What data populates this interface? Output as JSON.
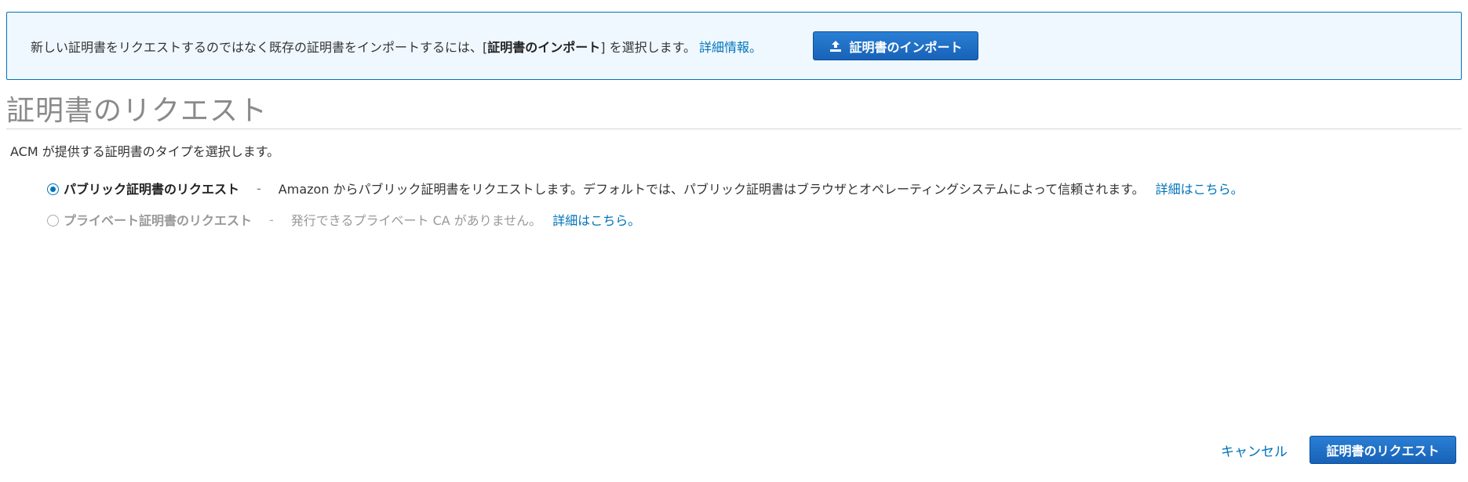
{
  "banner": {
    "message_prefix": "新しい証明書をリクエストするのではなく既存の証明書をインポートするには、[",
    "message_bold": "証明書のインポート",
    "message_suffix": "] を選択します。",
    "more_info_link": "詳細情報。",
    "import_button_label": "証明書のインポート",
    "import_button_icon": "upload-icon"
  },
  "page": {
    "title": "証明書のリクエスト",
    "description": "ACM が提供する証明書のタイプを選択します。"
  },
  "options": [
    {
      "label": "パブリック証明書のリクエスト",
      "separator": "-",
      "description": "Amazon からパブリック証明書をリクエストします。デフォルトでは、パブリック証明書はブラウザとオペレーティングシステムによって信頼されます。",
      "link": "詳細はこちら。",
      "selected": true,
      "disabled": false
    },
    {
      "label": "プライベート証明書のリクエスト",
      "separator": "-",
      "description": "発行できるプライベート CA がありません。",
      "link": "詳細はこちら。",
      "selected": false,
      "disabled": true
    }
  ],
  "footer": {
    "cancel_label": "キャンセル",
    "request_button_label": "証明書のリクエスト"
  },
  "colors": {
    "accent": "#0073bb",
    "primary_button": "#1762b8",
    "banner_background": "#f0f8ff",
    "title_gray": "#8a8a8a"
  }
}
